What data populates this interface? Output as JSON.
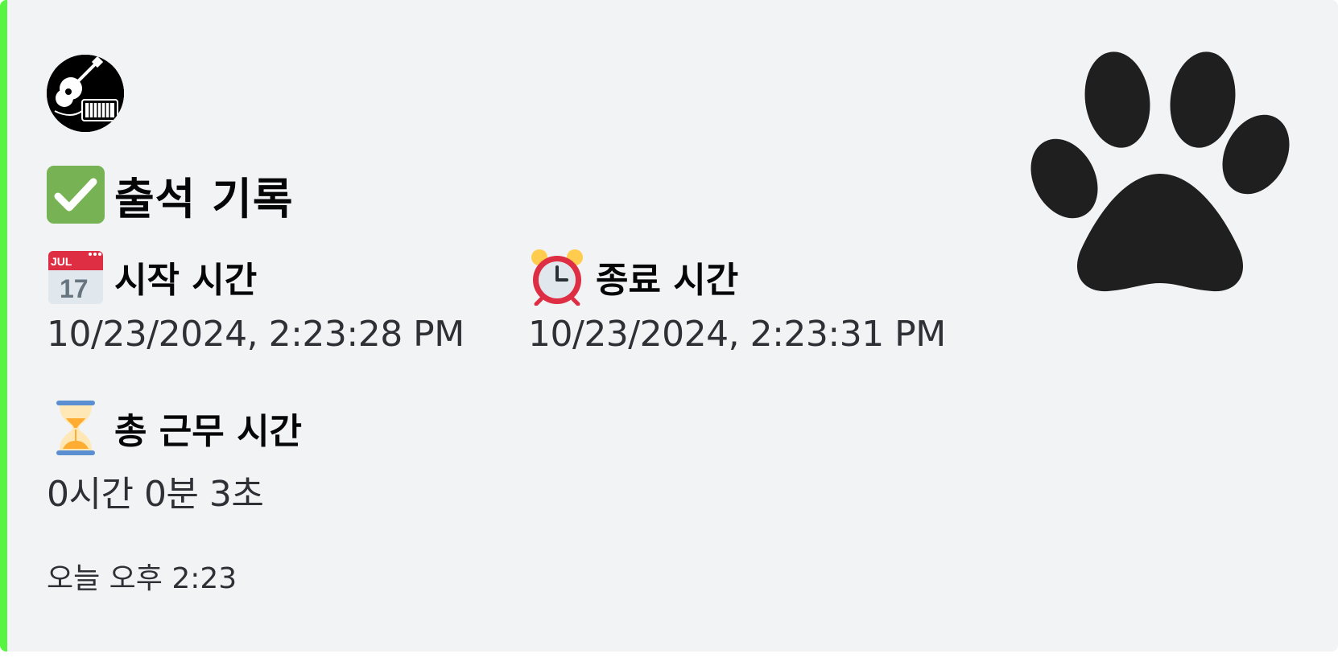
{
  "embed": {
    "accent_color": "#57f542",
    "author_icon": "guitar-keyboard-avatar",
    "thumbnail_icon": "paw-print-icon",
    "title_icon": "check-mark-button-icon",
    "title": "출석 기록",
    "fields": [
      {
        "icon": "calendar-icon",
        "calendar_month": "JUL",
        "calendar_day": "17",
        "name": "시작 시간",
        "value": "10/23/2024, 2:23:28 PM"
      },
      {
        "icon": "alarm-clock-icon",
        "name": "종료 시간",
        "value": "10/23/2024, 2:23:31 PM"
      },
      {
        "icon": "hourglass-icon",
        "name": "총 근무 시간",
        "value": "0시간 0분 3초"
      }
    ],
    "footer": "오늘 오후 2:23"
  }
}
